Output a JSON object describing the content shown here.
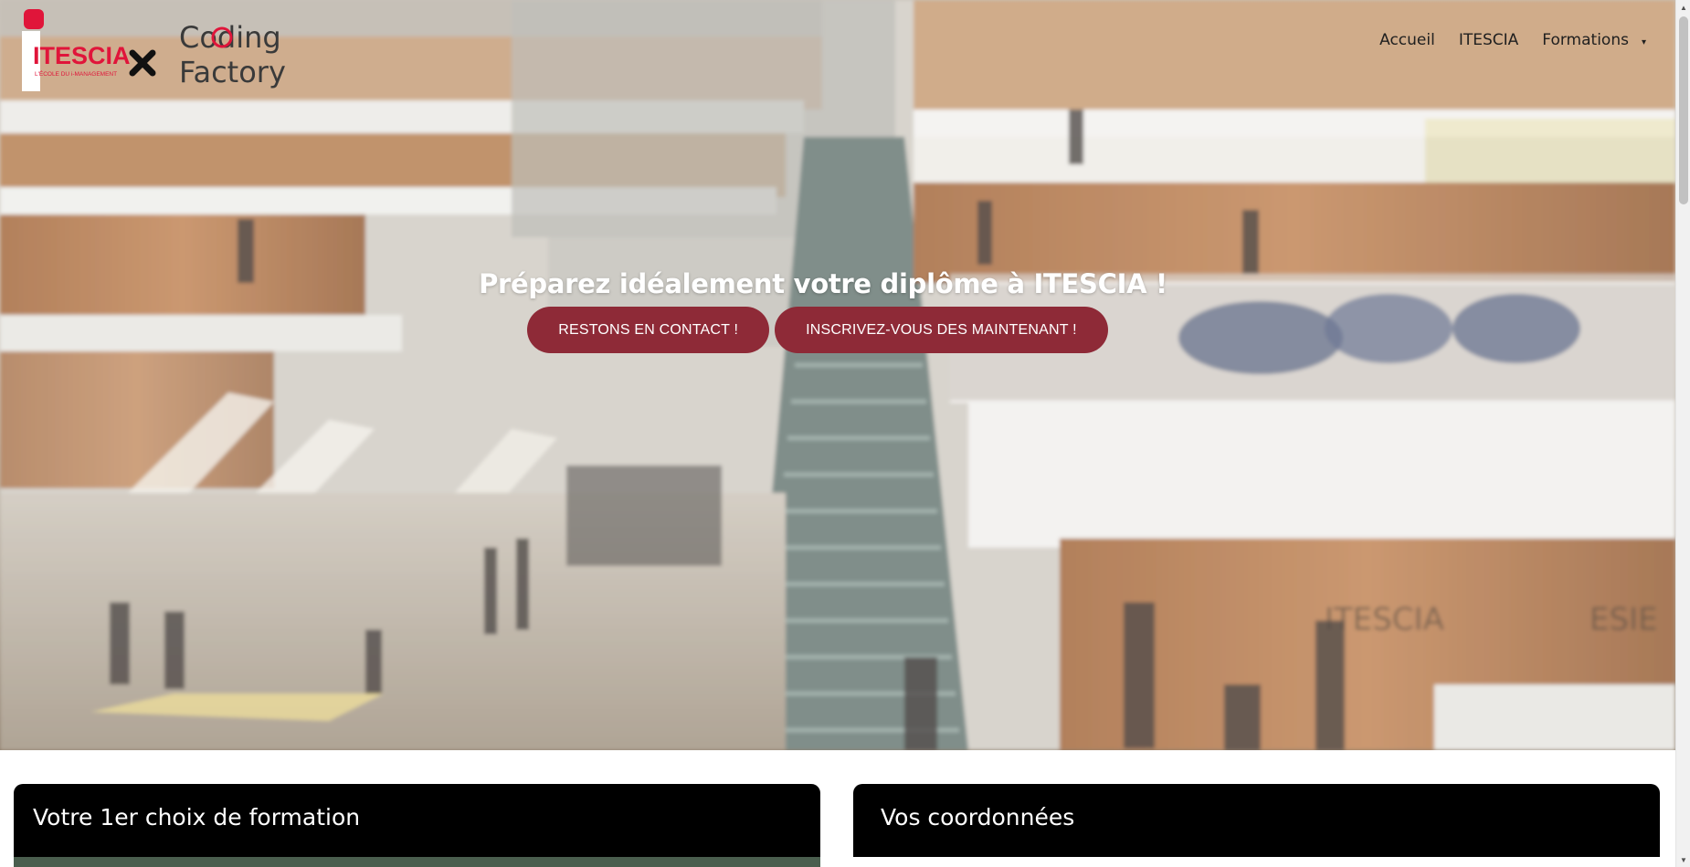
{
  "header": {
    "logo": {
      "brand_left": "ITESCIA",
      "brand_left_tagline": "L'ÉCOLE DU i-MANAGEMENT",
      "separator": "×",
      "brand_right_line1": "Coding",
      "brand_right_line2": "Factory",
      "accent_color": "#e0153a"
    },
    "nav": {
      "items": [
        {
          "label": "Accueil"
        },
        {
          "label": "ITESCIA"
        },
        {
          "label": "Formations",
          "has_dropdown": true,
          "caret": "▾"
        }
      ]
    }
  },
  "hero": {
    "title": "Préparez idéalement votre diplôme à ITESCIA !",
    "buttons": [
      {
        "label": "RESTONS EN CONTACT !"
      },
      {
        "label": "INSCRIVEZ-VOUS DES MAINTENANT !"
      }
    ],
    "button_color": "#8e2a37",
    "background_signs": [
      "ITESCIA",
      "ESIE"
    ]
  },
  "cards": [
    {
      "title": "Votre 1er choix de formation"
    },
    {
      "title": "Vos coordonnées"
    }
  ],
  "scrollbar": {
    "up_icon": "▲",
    "down_icon": "▼"
  }
}
